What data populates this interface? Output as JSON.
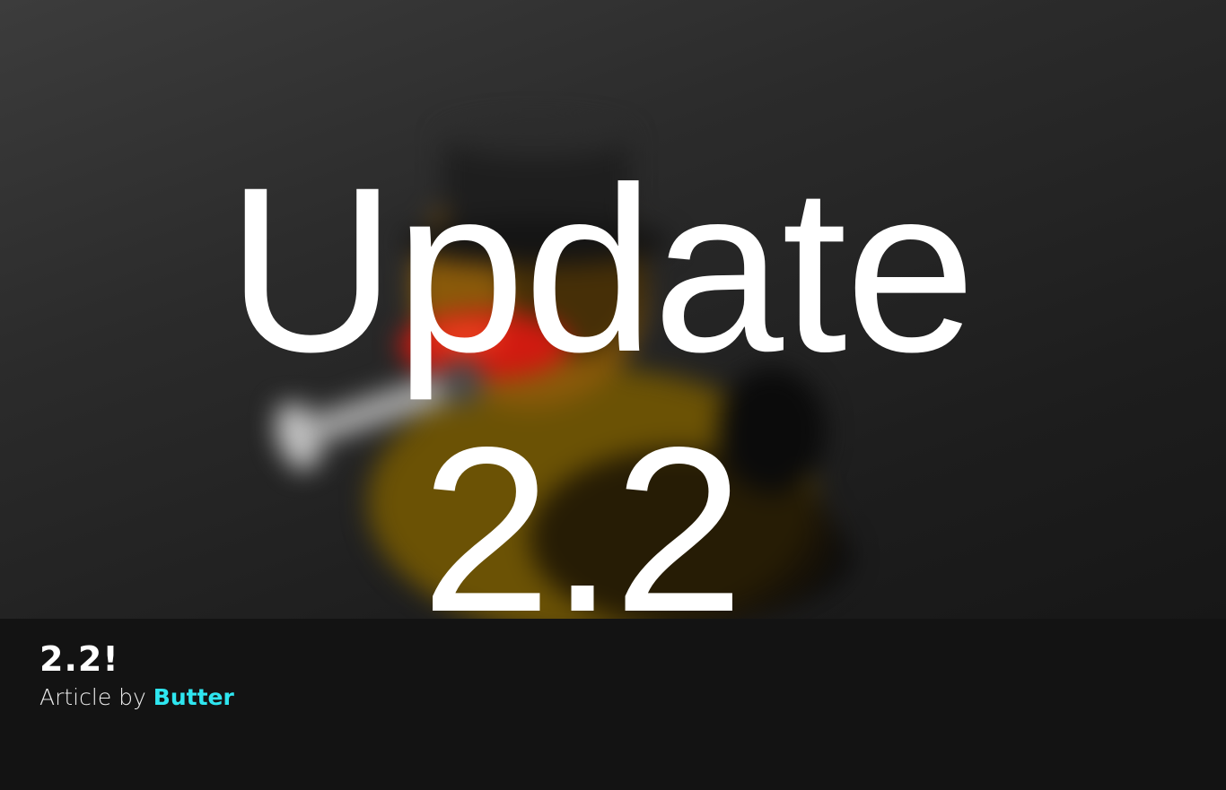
{
  "hero": {
    "title_line1": "Update",
    "title_line2": "2.2",
    "background_image": "blurred-rubber-duck-with-top-hat-and-wrench"
  },
  "article": {
    "heading": "2.2!",
    "byline_prefix": "Article by",
    "author": "Butter"
  },
  "colors": {
    "author_link": "#2ee6f0",
    "footer_background": "#131313",
    "text": "#ffffff"
  }
}
